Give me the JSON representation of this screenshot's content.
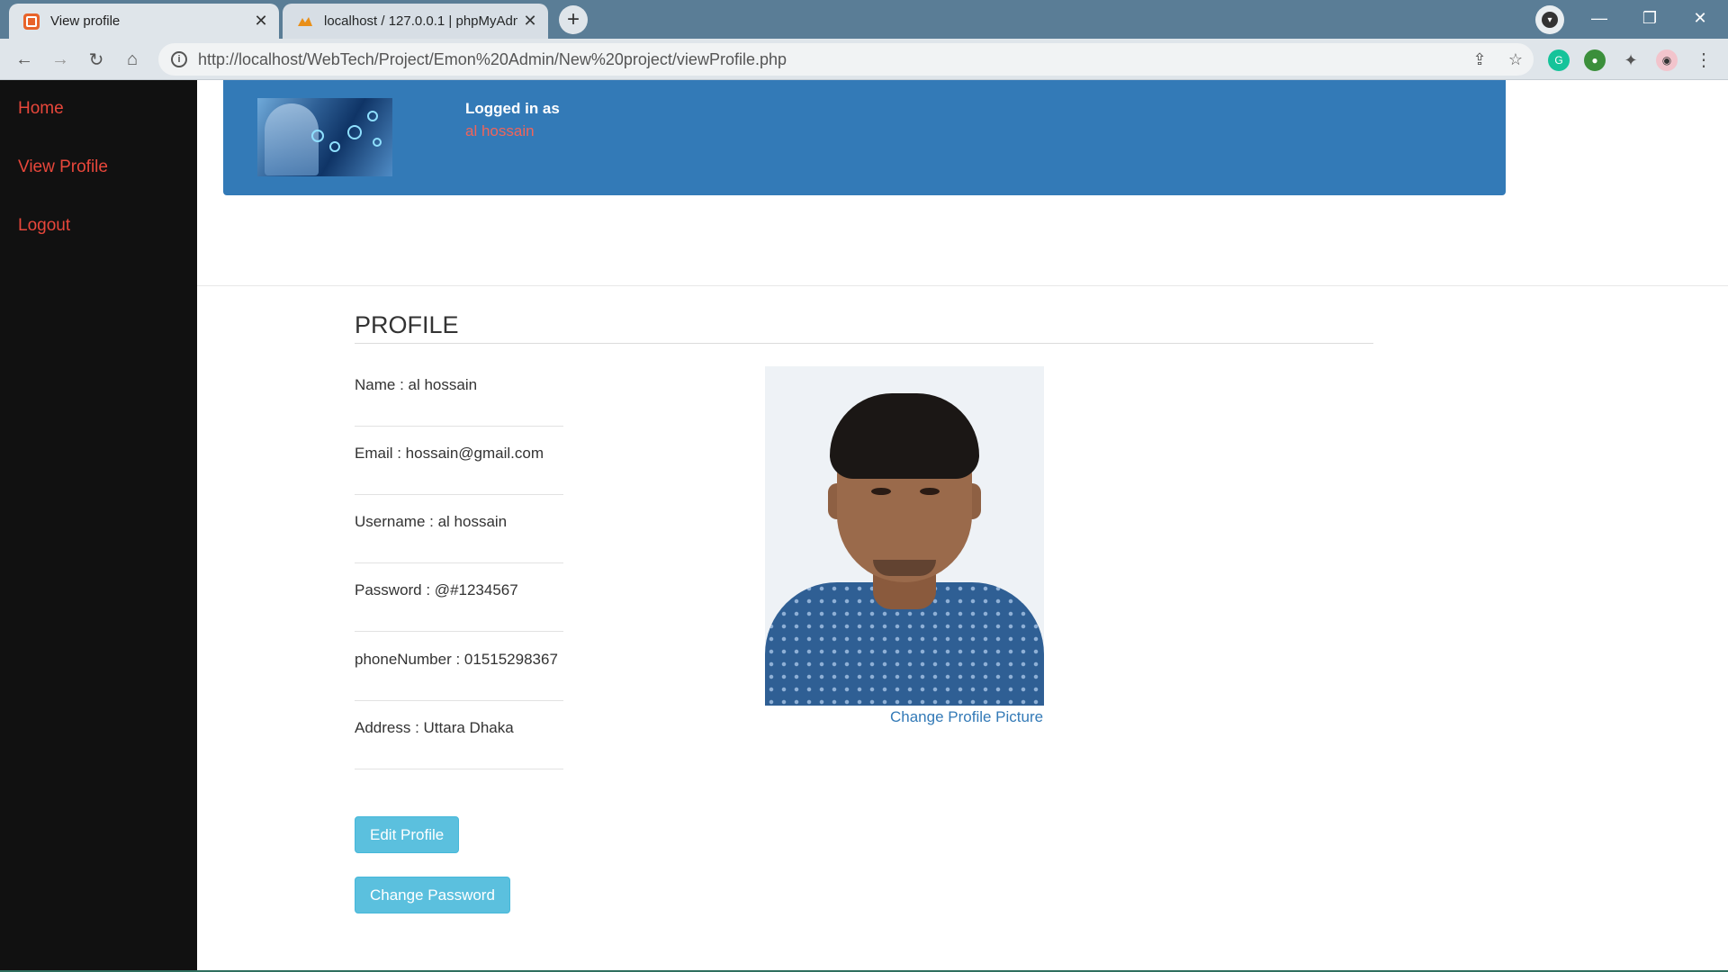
{
  "browser": {
    "tabs": [
      {
        "title": "View profile",
        "active": true
      },
      {
        "title": "localhost / 127.0.0.1 | phpMyAdm",
        "active": false
      }
    ],
    "new_tab_symbol": "+",
    "url": "http://localhost/WebTech/Project/Emon%20Admin/New%20project/viewProfile.php",
    "window_controls": {
      "minimize": "—",
      "restore": "❐",
      "close": "✕"
    },
    "nav": {
      "back": "←",
      "forward": "→",
      "reload": "↻",
      "home": "⌂"
    },
    "omnibox_tools": {
      "share": "⇪",
      "bookmark": "☆"
    },
    "menu": "⋮"
  },
  "sidebar": {
    "items": [
      {
        "label": "Home"
      },
      {
        "label": "View Profile"
      },
      {
        "label": "Logout"
      }
    ],
    "link_color": "#e8473b"
  },
  "header": {
    "logged_in_label": "Logged in as",
    "username": "al hossain",
    "band_color": "#337ab7"
  },
  "profile": {
    "title": "PROFILE",
    "fields": [
      {
        "text": "Name : al hossain"
      },
      {
        "text": "Email : hossain@gmail.com"
      },
      {
        "text": "Username : al hossain"
      },
      {
        "text": "Password : @#1234567"
      },
      {
        "text": "phoneNumber : 01515298367"
      },
      {
        "text": "Address : Uttara Dhaka"
      }
    ],
    "change_picture_link": "Change Profile Picture"
  },
  "actions": {
    "edit_profile": "Edit Profile",
    "change_password": "Change Password",
    "button_color": "#5bc0de"
  }
}
